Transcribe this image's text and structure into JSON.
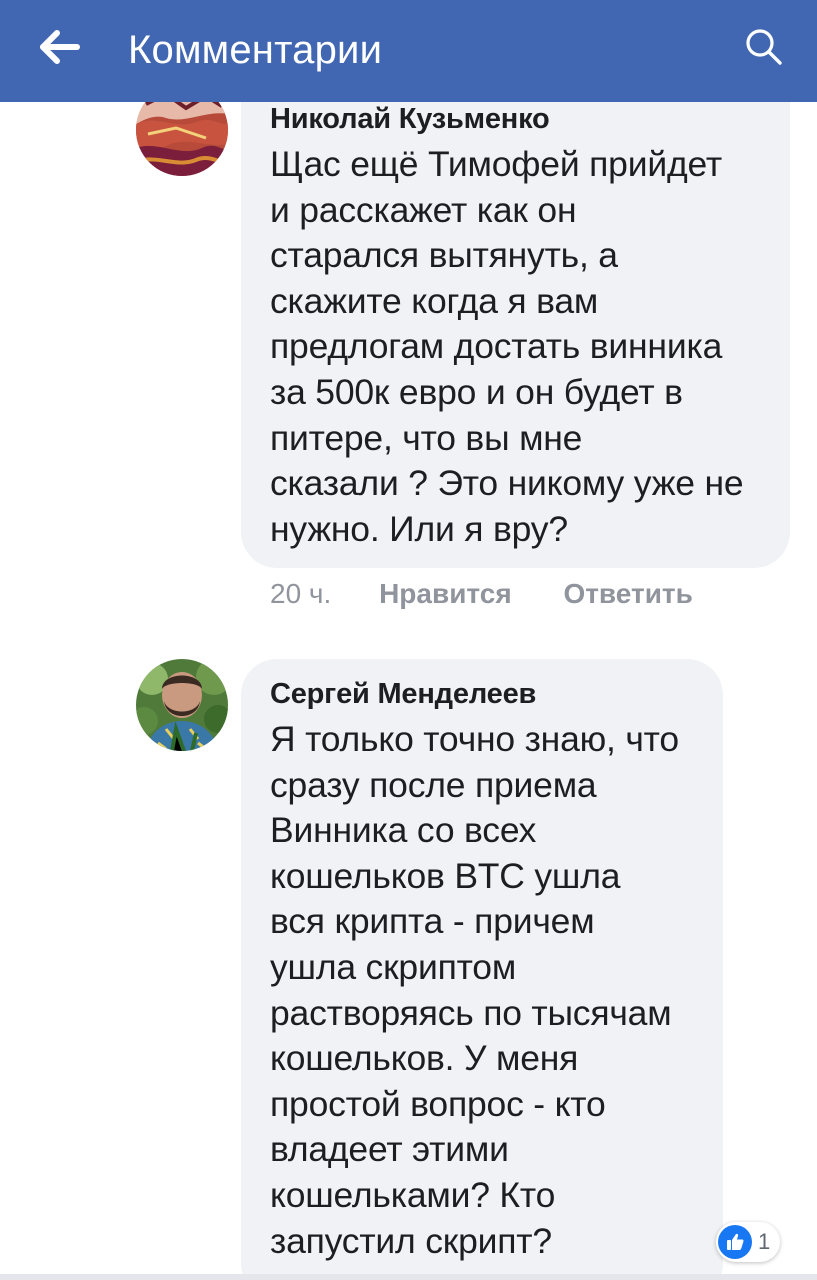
{
  "header": {
    "title": "Комментарии",
    "back_icon": "arrow-left-icon",
    "search_icon": "search-icon",
    "bg_color": "#4267b2"
  },
  "comments": [
    {
      "author": "Николай Кузьменко",
      "avatar_icon": "painting-avatar",
      "lines": [
        "Щас ещё Тимофей прийдет",
        "и расскажет как он",
        "старался вытянуть, а",
        "скажите когда я вам",
        "предлогам достать винника",
        "за 500к евро и он будет в",
        "питере, что вы мне",
        "сказали ? Это никому уже не",
        "нужно. Или я вру?"
      ],
      "time": "20 ч.",
      "like_label": "Нравится",
      "reply_label": "Ответить"
    },
    {
      "author": "Сергей Менделеев",
      "avatar_icon": "photo-avatar",
      "lines": [
        "Я только точно знаю, что",
        "сразу после приема",
        "Винника со всех",
        "кошельков BTC ушла",
        "вся крипта - причем",
        "ушла скриптом",
        "растворяясь по тысячам",
        "кошельков. У меня",
        "простой вопрос - кто",
        "владеет этими",
        "кошельками? Кто",
        "запустил скрипт?"
      ],
      "reaction_icon": "like-icon",
      "reaction_count": "1"
    }
  ]
}
